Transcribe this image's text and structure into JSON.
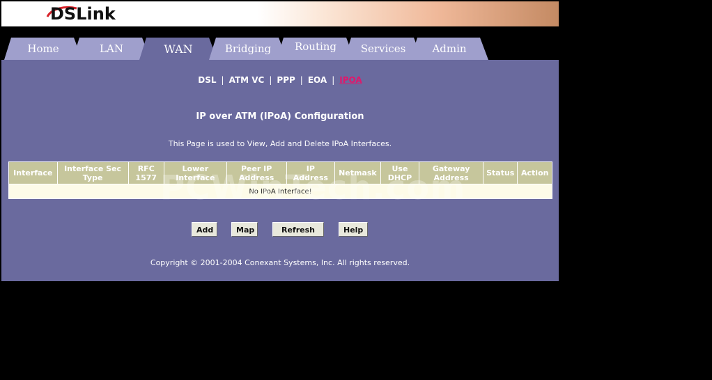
{
  "logo": {
    "text": "DSLink"
  },
  "tabs": [
    {
      "label": "Home",
      "active": false
    },
    {
      "label": "LAN",
      "active": false
    },
    {
      "label": "WAN",
      "active": true
    },
    {
      "label": "Bridging",
      "active": false
    },
    {
      "label": "Routing",
      "active": false
    },
    {
      "label": "Services",
      "active": false
    },
    {
      "label": "Admin",
      "active": false
    }
  ],
  "subnav": {
    "items": [
      "DSL",
      "ATM VC",
      "PPP",
      "EOA",
      "IPOA"
    ],
    "separator": "|",
    "active": "IPOA"
  },
  "page": {
    "title": "IP over ATM (IPoA) Configuration",
    "description": "This Page is used to View, Add and Delete IPoA Interfaces.",
    "copyright": "Copyright © 2001-2004 Conexant Systems, Inc. All rights reserved."
  },
  "table": {
    "columns": [
      "Interface",
      "Interface Sec Type",
      "RFC 1577",
      "Lower Interface",
      "Peer IP Address",
      "IP Address",
      "Netmask",
      "Use DHCP",
      "Gateway Address",
      "Status",
      "Action"
    ],
    "empty_message": "No IPoA Interface!"
  },
  "buttons": {
    "add": "Add",
    "map": "Map",
    "refresh": "Refresh",
    "help": "Help"
  },
  "watermark": "PCWinTech.com",
  "colors": {
    "content_bg": "#6a6a9e",
    "tab_inactive": "#9f9fcc",
    "tab_active": "#6a6a9e",
    "header_cell": "#c6c69c",
    "active_link": "#e0186c"
  }
}
